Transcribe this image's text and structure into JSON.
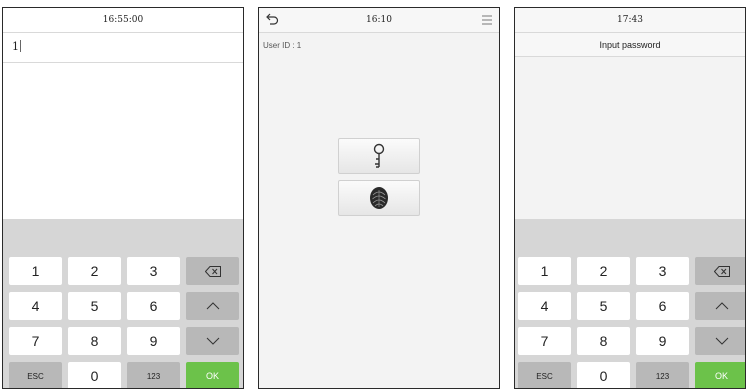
{
  "screen1": {
    "time": "16:55:00",
    "input_value": "1",
    "keypad": {
      "rows": [
        [
          "1",
          "2",
          "3",
          "backspace-icon"
        ],
        [
          "4",
          "5",
          "6",
          "chevron-up-icon"
        ],
        [
          "7",
          "8",
          "9",
          "chevron-down-icon"
        ],
        [
          "ESC",
          "0",
          "123",
          "OK"
        ]
      ]
    }
  },
  "screen2": {
    "time": "16:10",
    "user_id": "User ID : 1",
    "icons": [
      "back-icon",
      "menu-icon",
      "key-icon",
      "fingerprint-icon"
    ]
  },
  "screen3": {
    "time": "17:43",
    "title": "Input password",
    "keypad": {
      "rows": [
        [
          "1",
          "2",
          "3",
          "backspace-icon"
        ],
        [
          "4",
          "5",
          "6",
          "chevron-up-icon"
        ],
        [
          "7",
          "8",
          "9",
          "chevron-down-icon"
        ],
        [
          "ESC",
          "0",
          "123",
          "OK"
        ]
      ]
    }
  },
  "colors": {
    "ok_green": "#6cc24a",
    "key_dark": "#b8b8b8",
    "keypad_bg": "#d6d6d6",
    "border": "#2a2a2a"
  }
}
